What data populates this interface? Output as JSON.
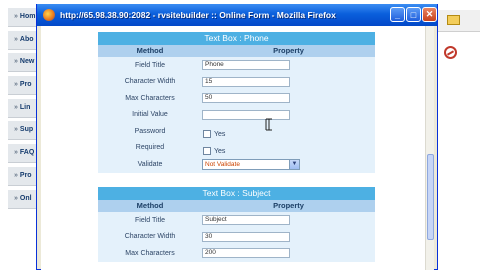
{
  "window": {
    "title": "http://65.98.38.90:2082 - rvsitebuilder :: Online Form - Mozilla Firefox",
    "buttons": {
      "minimize": "_",
      "maximize": "□",
      "close": "✕"
    }
  },
  "background_nav": {
    "items": [
      "Hom",
      "Abo",
      "New",
      "Pro",
      "Lin",
      "Sup",
      "FAQ",
      "Pro",
      "Onl"
    ]
  },
  "sections": [
    {
      "title": "Text Box : Phone",
      "headers": {
        "method": "Method",
        "property": "Property"
      },
      "rows": {
        "field_title": {
          "label": "Field Title",
          "value": "Phone"
        },
        "char_width": {
          "label": "Character Width",
          "value": "15"
        },
        "max_chars": {
          "label": "Max Characters",
          "value": "50"
        },
        "initial_value": {
          "label": "Initial Value",
          "value": ""
        },
        "password": {
          "label": "Password",
          "option": "Yes"
        },
        "required": {
          "label": "Required",
          "option": "Yes"
        },
        "validate": {
          "label": "Validate",
          "value": "Not Validate"
        }
      }
    },
    {
      "title": "Text Box : Subject",
      "headers": {
        "method": "Method",
        "property": "Property"
      },
      "rows": {
        "field_title": {
          "label": "Field Title",
          "value": "Subject"
        },
        "char_width": {
          "label": "Character Width",
          "value": "30"
        },
        "max_chars": {
          "label": "Max Characters",
          "value": "200"
        }
      }
    }
  ],
  "colors": {
    "section_title": "#4db0e3",
    "header_row": "#aed0ee",
    "body": "#e4f1fb",
    "titlebar": "#0a5fdc"
  },
  "icons": {
    "window": "firefox-icon",
    "background_folder": "folder-icon",
    "background_stop": "no-entry-icon",
    "pointer": "mouse-cursor-icon"
  }
}
